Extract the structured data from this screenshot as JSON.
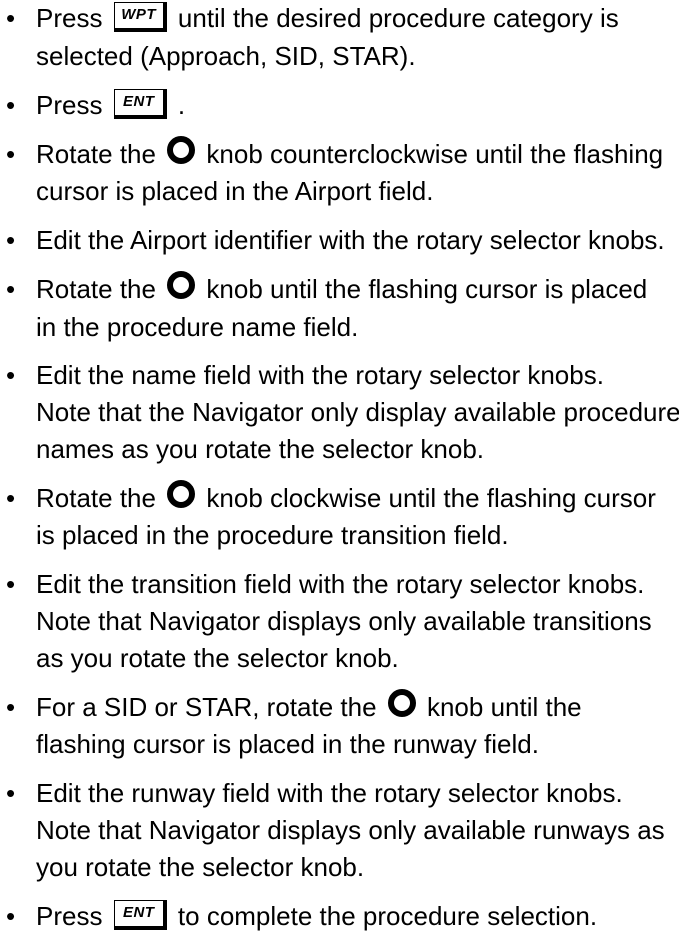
{
  "instructions": {
    "steps": [
      {
        "lines": [
          [
            "Press ",
            {
              "key": "WPT"
            },
            " until the desired procedure category is"
          ],
          [
            "selected (Approach, SID, STAR)."
          ]
        ]
      },
      {
        "lines": [
          [
            "Press ",
            {
              "key": "ENT"
            },
            " ."
          ]
        ]
      },
      {
        "lines": [
          [
            "Rotate the ",
            {
              "icon": "knob-icon"
            },
            " knob counterclockwise until the flashing"
          ],
          [
            "cursor is placed in the Airport field."
          ]
        ]
      },
      {
        "lines": [
          [
            "Edit the Airport identifier with the rotary selector knobs."
          ]
        ]
      },
      {
        "lines": [
          [
            "Rotate the ",
            {
              "icon": "knob-icon"
            },
            " knob until the flashing cursor is placed"
          ],
          [
            "in the procedure name field."
          ]
        ]
      },
      {
        "lines": [
          [
            "Edit the name field with the rotary selector knobs."
          ],
          [
            "Note that the Navigator only display available procedure"
          ],
          [
            "names as you rotate the selector knob."
          ]
        ]
      },
      {
        "lines": [
          [
            "Rotate the ",
            {
              "icon": "knob-icon"
            },
            " knob clockwise until the flashing cursor"
          ],
          [
            "is placed in the procedure transition field."
          ]
        ]
      },
      {
        "lines": [
          [
            "Edit the transition field with the rotary selector knobs."
          ],
          [
            "Note that Navigator displays only available transitions"
          ],
          [
            "as you rotate the selector knob."
          ]
        ]
      },
      {
        "lines": [
          [
            "For a SID or STAR, rotate the ",
            {
              "icon": "knob-icon"
            },
            " knob until the"
          ],
          [
            "flashing cursor is placed in the runway field."
          ]
        ]
      },
      {
        "lines": [
          [
            "Edit the runway field with the rotary selector knobs."
          ],
          [
            "Note that Navigator displays only available runways as"
          ],
          [
            "you rotate the selector knob."
          ]
        ]
      },
      {
        "lines": [
          [
            "Press ",
            {
              "key": "ENT"
            },
            " to complete the procedure selection."
          ]
        ]
      }
    ]
  }
}
